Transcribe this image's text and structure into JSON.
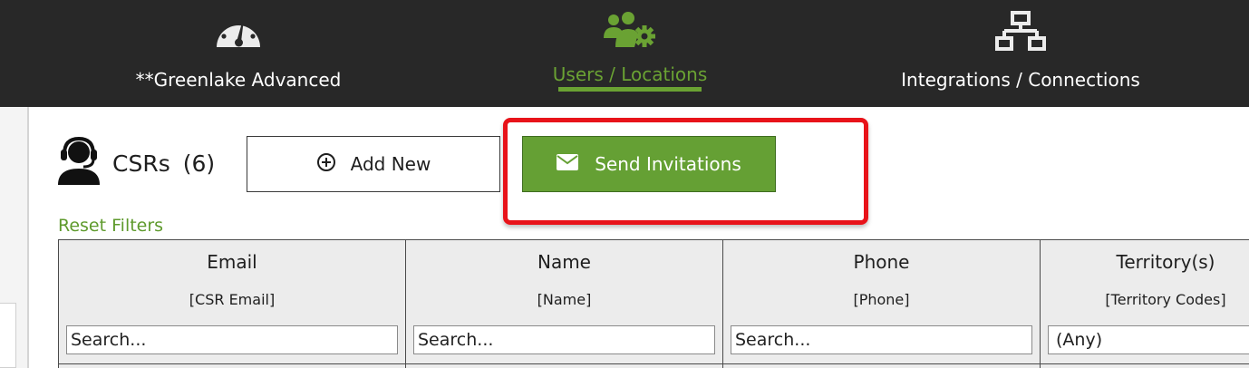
{
  "nav": {
    "items": [
      {
        "label": "**Greenlake Advanced",
        "icon": "dashboard-gauge-icon",
        "active": false
      },
      {
        "label": "Users / Locations",
        "icon": "users-gear-icon",
        "active": true
      },
      {
        "label": "Integrations / Connections",
        "icon": "network-icon",
        "active": false
      }
    ]
  },
  "section": {
    "title": "CSRs",
    "count": "(6)",
    "icon": "headset-user-icon"
  },
  "actions": {
    "add_label": "Add New",
    "send_label": "Send Invitations"
  },
  "filters": {
    "reset_label": "Reset Filters"
  },
  "table": {
    "columns": [
      {
        "header": "Email",
        "sub": "[CSR Email]",
        "placeholder": "Search..."
      },
      {
        "header": "Name",
        "sub": "[Name]",
        "placeholder": "Search..."
      },
      {
        "header": "Phone",
        "sub": "[Phone]",
        "placeholder": "Search..."
      },
      {
        "header": "Territory(s)",
        "sub": "[Territory Codes]",
        "selected": "(Any)"
      }
    ]
  },
  "colors": {
    "nav_bg": "#282828",
    "accent_green": "#65a034",
    "highlight_red": "#e8131a"
  }
}
